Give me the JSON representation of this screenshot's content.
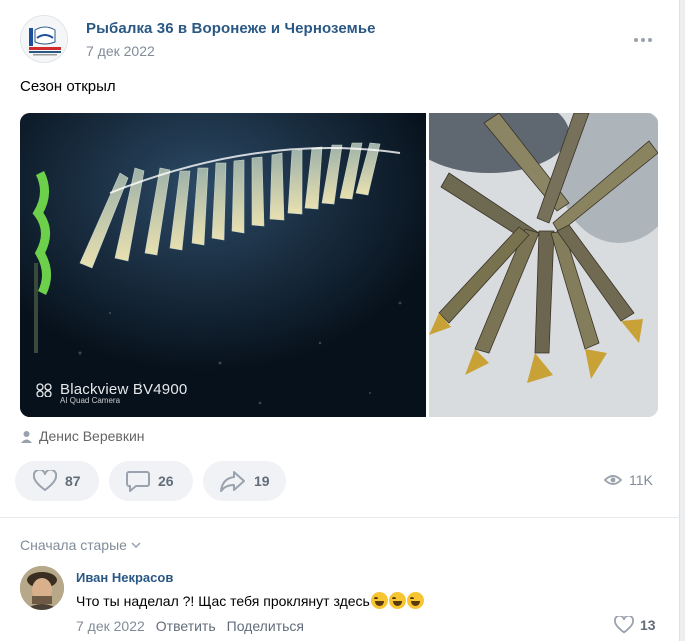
{
  "post": {
    "group_name": "Рыбалка 36 в Воронеже и Черноземье",
    "date": "7 дек 2022",
    "text": "Сезон открыл",
    "photo_left": {
      "watermark_title": "Blackview BV4900",
      "watermark_sub": "AI Quad Camera"
    },
    "author": "Денис Веревкин",
    "actions": {
      "likes": "87",
      "comments": "26",
      "shares": "19",
      "views": "11K"
    },
    "icons": [
      "more-icon",
      "user-icon",
      "heart-icon",
      "comment-icon",
      "share-icon",
      "eye-icon",
      "chevron-down-icon"
    ]
  },
  "comments": {
    "sort_label": "Сначала старые",
    "items": [
      {
        "author": "Иван Некрасов",
        "text": "Что ты наделал ?! Щас тебя проклянут здесь",
        "emoji_count": 3,
        "date": "7 дек 2022",
        "reply_label": "Ответить",
        "share_label": "Поделиться",
        "likes": "13"
      }
    ]
  },
  "colors": {
    "link": "#2a5885",
    "muted": "#818c99",
    "button_bg": "#f0f2f5",
    "icon": "#99a2ad"
  }
}
